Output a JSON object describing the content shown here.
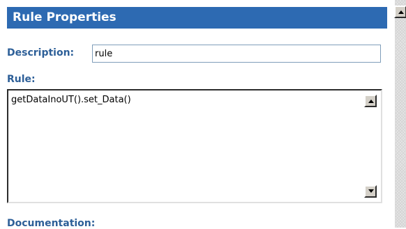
{
  "panel": {
    "title": "Rule Properties"
  },
  "description": {
    "label": "Description:",
    "value": "rule"
  },
  "rule": {
    "label": "Rule:",
    "text": "getDataInoUT().set_Data()"
  },
  "documentation": {
    "label": "Documentation:"
  },
  "icons": {
    "scroll_up": "triangle-up-icon",
    "scroll_down": "triangle-down-icon"
  },
  "colors": {
    "header_bg": "#2d6ab2",
    "label_text": "#2d5f98"
  }
}
